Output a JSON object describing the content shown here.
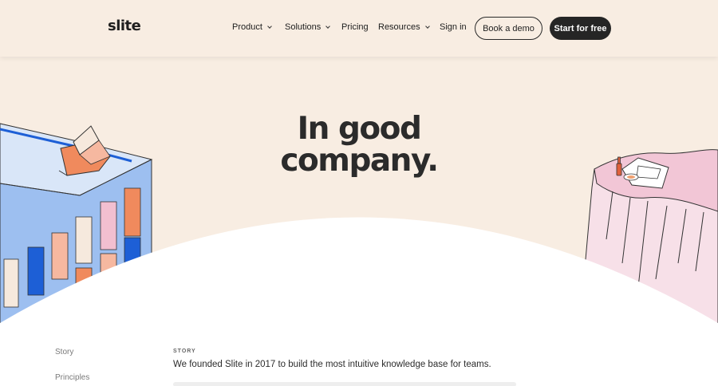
{
  "brand": {
    "logo_text": "slite"
  },
  "nav": {
    "items": [
      {
        "label": "Product",
        "has_dropdown": true
      },
      {
        "label": "Solutions",
        "has_dropdown": true
      },
      {
        "label": "Pricing",
        "has_dropdown": false
      },
      {
        "label": "Resources",
        "has_dropdown": true
      },
      {
        "label": "Sign in",
        "has_dropdown": false
      }
    ],
    "book_demo_label": "Book a demo",
    "start_free_label": "Start for free"
  },
  "hero": {
    "title_line1": "In good",
    "title_line2": "company."
  },
  "sidebar": {
    "links": [
      {
        "label": "Story"
      },
      {
        "label": "Principles"
      }
    ]
  },
  "content": {
    "section_label": "STORY",
    "intro_text": "We founded Slite in 2017 to build the most intuitive knowledge base for teams."
  },
  "colors": {
    "page_background": "#f8ede2",
    "dark_button": "#252525",
    "building_blue": "#9dbff0",
    "accent_orange": "#f08a5d",
    "pink_cliff": "#f2c8d7"
  }
}
